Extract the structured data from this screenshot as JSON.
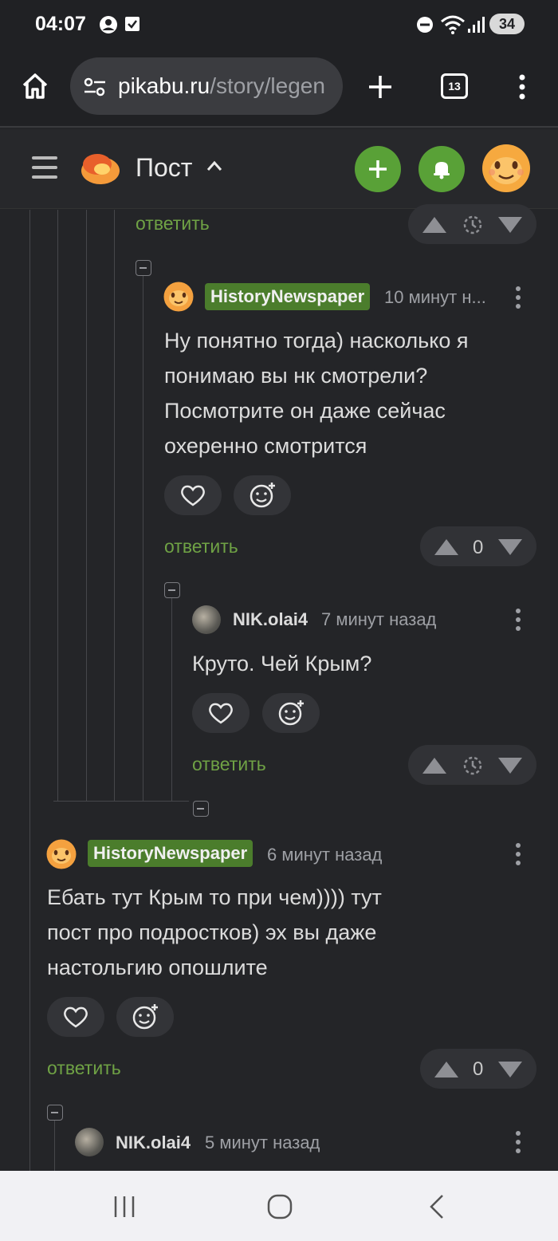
{
  "status_bar": {
    "time": "04:07",
    "battery": "34"
  },
  "browser": {
    "url_domain": "pikabu.ru",
    "url_path": "/story/legen",
    "tab_count": "13"
  },
  "header": {
    "title": "Пост"
  },
  "comments": [
    {
      "author": "HistoryNewspaper",
      "time": "10 минут н...",
      "text_lines": [
        "Ну понятно тогда) насколько я",
        "понимаю вы нк смотрели?",
        "Посмотрите он даже сейчас",
        "охеренно смотрится"
      ],
      "reply_label": "ответить",
      "rating": "0"
    },
    {
      "author": "NIK.olai4",
      "time": "7 минут назад",
      "text_lines": [
        "Круто. Чей Крым?"
      ],
      "reply_label": "ответить"
    },
    {
      "author": "HistoryNewspaper",
      "time": "6 минут назад",
      "text_lines": [
        "Ебать тут Крым то при чем)))) тут",
        "пост про подростков) эх вы даже",
        "настольгию опошлите"
      ],
      "reply_label": "ответить",
      "rating": "0"
    },
    {
      "author": "NIK.olai4",
      "time": "5 минут назад"
    }
  ],
  "top_reply_label": "ответить",
  "colors": {
    "accent_green": "#59a137",
    "reply_green": "#6fa245",
    "badge_green": "#4b7d2c",
    "background": "#242528"
  },
  "icons": [
    "home-icon",
    "site-settings-icon",
    "plus-icon",
    "tabs-icon",
    "more-vert-icon",
    "menu-icon",
    "pikabu-logo",
    "chevron-up-icon",
    "bell-icon",
    "heart-icon",
    "emoji-add-icon",
    "arrow-up-icon",
    "arrow-down-icon",
    "timer-icon",
    "collapse-icon"
  ]
}
